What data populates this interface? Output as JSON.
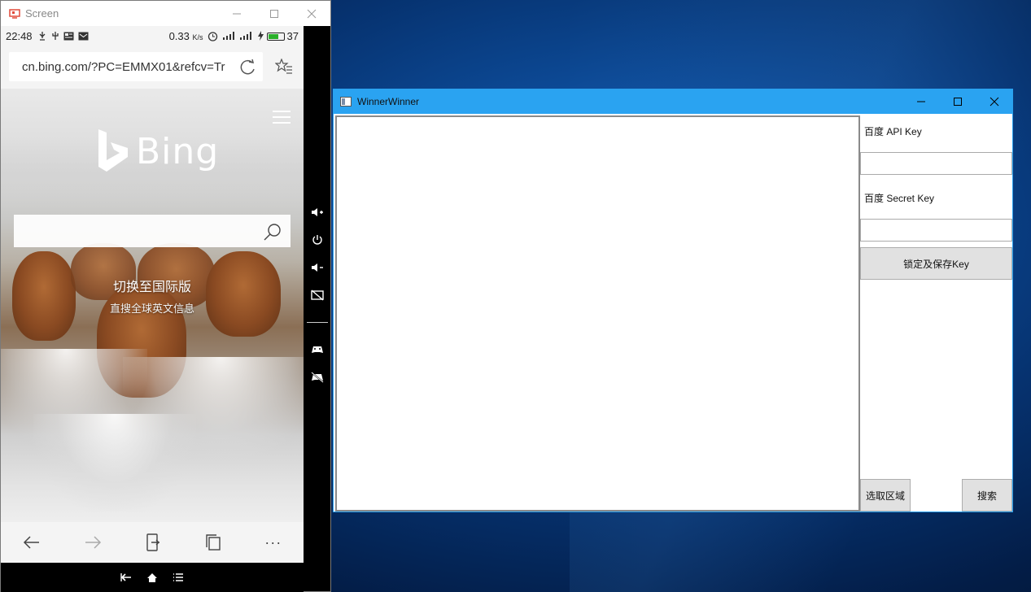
{
  "colors": {
    "desktop": "#0d4c9a",
    "ww_titlebar": "#2aa3f1",
    "button_face": "#e1e1e1",
    "battery_fill": "#2bb02b"
  },
  "screen_window": {
    "title": "Screen",
    "icon": "screen-app-icon",
    "caption": {
      "minimize": "minimize-icon",
      "maximize": "maximize-icon",
      "close": "close-icon"
    }
  },
  "phone": {
    "status": {
      "time": "22:48",
      "net_rate": "0.33",
      "net_rate_unit": "K/s",
      "battery": "37"
    },
    "browser": {
      "url": "cn.bing.com/?PC=EMMX01&refcv=Tr",
      "reload_icon": "reload-icon",
      "favorite_icon": "favorite-star-icon"
    },
    "bing": {
      "logo_text": "Bing",
      "search_placeholder": "",
      "intl_link": "切换至国际版",
      "intl_sub": "直搜全球英文信息"
    },
    "bottom_nav": [
      "back-icon",
      "forward-icon",
      "share-to-pc-icon",
      "tabs-icon",
      "more-icon"
    ],
    "more_label": "···",
    "android_nav": [
      "back-icon",
      "home-icon",
      "menu-icon"
    ]
  },
  "side_controls": [
    "volume-up-icon",
    "power-icon",
    "volume-down-icon",
    "screen-off-icon",
    "gamepad-icon",
    "gamepad-off-icon"
  ],
  "winner_window": {
    "title": "WinnerWinner",
    "api_key_label": "百度 API Key",
    "api_key_value": "",
    "secret_key_label": "百度 Secret Key",
    "secret_key_value": "",
    "lock_save_button": "锁定及保存Key",
    "select_region_button": "选取区域",
    "search_button": "搜索"
  }
}
